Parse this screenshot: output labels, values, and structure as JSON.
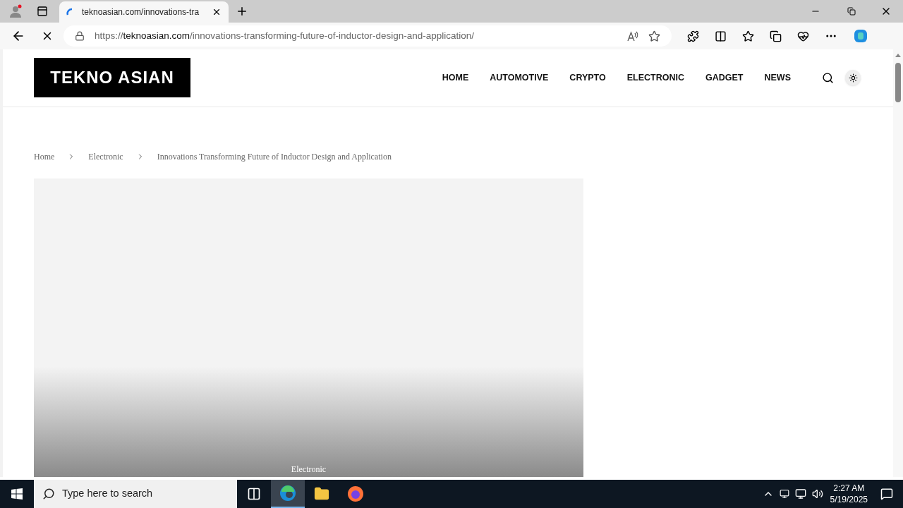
{
  "browser": {
    "tab_title": "teknoasian.com/innovations-tra",
    "url_scheme": "https://",
    "url_domain": "teknoasian.com",
    "url_path": "/innovations-transforming-future-of-inductor-design-and-application/"
  },
  "site": {
    "logo": "TEKNO ASIAN",
    "nav": [
      "HOME",
      "AUTOMOTIVE",
      "CRYPTO",
      "ELECTRONIC",
      "GADGET",
      "NEWS"
    ],
    "breadcrumb": [
      "Home",
      "Electronic",
      "Innovations Transforming Future of Inductor Design and Application"
    ],
    "featured": {
      "category": "Electronic"
    }
  },
  "taskbar": {
    "search_placeholder": "Type here to search",
    "time": "2:27 AM",
    "date": "5/19/2025"
  }
}
